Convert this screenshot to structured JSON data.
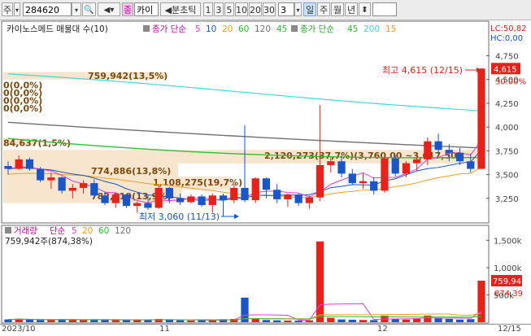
{
  "toolbar": {
    "menu_label": "주",
    "code": "284620",
    "name_tab": "카이",
    "period_label": "◀분초틱",
    "minute_intervals": [
      "1",
      "3",
      "5",
      "10",
      "20",
      "30"
    ],
    "interval_value": "3",
    "period_tabs": [
      "일",
      "주",
      "월",
      "년"
    ],
    "active_period": "일"
  },
  "legend_main": {
    "indicator": "카이노스메드 매물대 수(10)",
    "ma_title": "종가 단순",
    "ma_periods": [
      "5",
      "10",
      "20",
      "60",
      "120",
      "45"
    ],
    "ma2_title": "종가 단순",
    "ma2_periods": [
      "45",
      "200",
      "15"
    ]
  },
  "price_axis": {
    "lc": "LC:50,82",
    "hc": "HC:0,00",
    "ticks": [
      "4,750",
      "4,500",
      "4,250",
      "4,000",
      "3,750",
      "3,500",
      "3,250"
    ],
    "current_price": "4,615",
    "current_change": "30.00%"
  },
  "volume_profile": [
    {
      "label": "759,942(13,5%)"
    },
    {
      "label": "0(0,0%)"
    },
    {
      "label": "0(0,0%)"
    },
    {
      "label": "0(0,0%)"
    },
    {
      "label": "0(0,0%)"
    },
    {
      "label": "84,637(1,5%)"
    },
    {
      "label": "2,120,273(37,7%)(3,760,00 ~3,617,50)"
    },
    {
      "label": "774,886(13,8%)"
    },
    {
      "label": "1,108,275(19,7%)"
    },
    {
      "label": "782,019(13,9%)"
    }
  ],
  "annotations": {
    "high": "최고 4,615 (12/15)",
    "low": "최저 3,060 (11/13)"
  },
  "legend_volume": {
    "title": "거래량",
    "ma_title": "단순",
    "ma_periods": [
      "5",
      "20",
      "60",
      "120"
    ],
    "value_label": "759,942주(874,38%)"
  },
  "volume_axis": {
    "ticks": [
      "1,500k",
      "1,000k",
      "500k"
    ],
    "current_volume": "759,94",
    "current_ratio": "874,39"
  },
  "date_axis": [
    "2023/10",
    "11",
    "12",
    "12/15"
  ],
  "colors": {
    "up": "#e8221b",
    "down": "#1a56c8",
    "ma5": "#e040d0",
    "ma10": "#1a56c8",
    "ma20": "#f0a020",
    "ma60": "#30c030",
    "ma120": "#707070",
    "ma200": "#40d8d8"
  },
  "chart_data": {
    "type": "candlestick",
    "dates": [
      "10/16",
      "10/17",
      "10/18",
      "10/19",
      "10/20",
      "10/23",
      "10/24",
      "10/25",
      "10/26",
      "10/27",
      "10/30",
      "10/31",
      "11/01",
      "11/02",
      "11/03",
      "11/06",
      "11/07",
      "11/08",
      "11/09",
      "11/10",
      "11/13",
      "11/14",
      "11/15",
      "11/16",
      "11/17",
      "11/20",
      "11/21",
      "11/22",
      "11/23",
      "11/24",
      "11/27",
      "11/28",
      "11/29",
      "11/30",
      "12/01",
      "12/04",
      "12/05",
      "12/06",
      "12/07",
      "12/08",
      "12/11",
      "12/12",
      "12/13",
      "12/14",
      "12/15"
    ],
    "candles": [
      [
        3590,
        3640,
        3500,
        3560
      ],
      [
        3560,
        3700,
        3550,
        3660
      ],
      [
        3660,
        3680,
        3540,
        3560
      ],
      [
        3560,
        3580,
        3420,
        3440
      ],
      [
        3440,
        3520,
        3350,
        3470
      ],
      [
        3470,
        3480,
        3300,
        3330
      ],
      [
        3330,
        3400,
        3250,
        3360
      ],
      [
        3360,
        3440,
        3300,
        3410
      ],
      [
        3410,
        3450,
        3250,
        3280
      ],
      [
        3280,
        3320,
        3180,
        3200
      ],
      [
        3200,
        3310,
        3150,
        3290
      ],
      [
        3290,
        3300,
        3150,
        3170
      ],
      [
        3170,
        3220,
        3100,
        3200
      ],
      [
        3200,
        3280,
        3130,
        3150
      ],
      [
        3150,
        3390,
        3140,
        3360
      ],
      [
        3360,
        3370,
        3200,
        3250
      ],
      [
        3250,
        3300,
        3180,
        3210
      ],
      [
        3210,
        3290,
        3200,
        3270
      ],
      [
        3270,
        3290,
        3160,
        3180
      ],
      [
        3180,
        3300,
        3100,
        3280
      ],
      [
        3280,
        3300,
        3060,
        3230
      ],
      [
        3230,
        3400,
        3200,
        3360
      ],
      [
        3360,
        4020,
        3210,
        3230
      ],
      [
        3230,
        3470,
        3200,
        3460
      ],
      [
        3460,
        3470,
        3250,
        3340
      ],
      [
        3340,
        3400,
        3200,
        3240
      ],
      [
        3240,
        3300,
        3160,
        3290
      ],
      [
        3290,
        3300,
        3170,
        3200
      ],
      [
        3200,
        3280,
        3140,
        3260
      ],
      [
        3260,
        4230,
        3220,
        3600
      ],
      [
        3600,
        3680,
        3520,
        3640
      ],
      [
        3640,
        3700,
        3470,
        3510
      ],
      [
        3510,
        3560,
        3390,
        3410
      ],
      [
        3410,
        3520,
        3350,
        3430
      ],
      [
        3430,
        3470,
        3290,
        3330
      ],
      [
        3330,
        3690,
        3310,
        3670
      ],
      [
        3670,
        3700,
        3480,
        3510
      ],
      [
        3510,
        3640,
        3470,
        3620
      ],
      [
        3620,
        3700,
        3540,
        3660
      ],
      [
        3660,
        3890,
        3600,
        3850
      ],
      [
        3850,
        3930,
        3720,
        3760
      ],
      [
        3760,
        3820,
        3640,
        3730
      ],
      [
        3730,
        3780,
        3600,
        3640
      ],
      [
        3640,
        3720,
        3520,
        3560
      ],
      [
        3560,
        4615,
        3560,
        4615
      ]
    ],
    "volume": [
      50,
      60,
      45,
      40,
      42,
      55,
      48,
      36,
      50,
      44,
      40,
      38,
      42,
      48,
      60,
      38,
      34,
      30,
      36,
      40,
      55,
      60,
      450,
      70,
      40,
      34,
      30,
      28,
      32,
      1480,
      80,
      50,
      44,
      40,
      38,
      120,
      60,
      48,
      64,
      120,
      80,
      60,
      48,
      55,
      760
    ],
    "price_range": [
      3000,
      4900
    ],
    "volume_range": [
      0,
      1700
    ]
  }
}
